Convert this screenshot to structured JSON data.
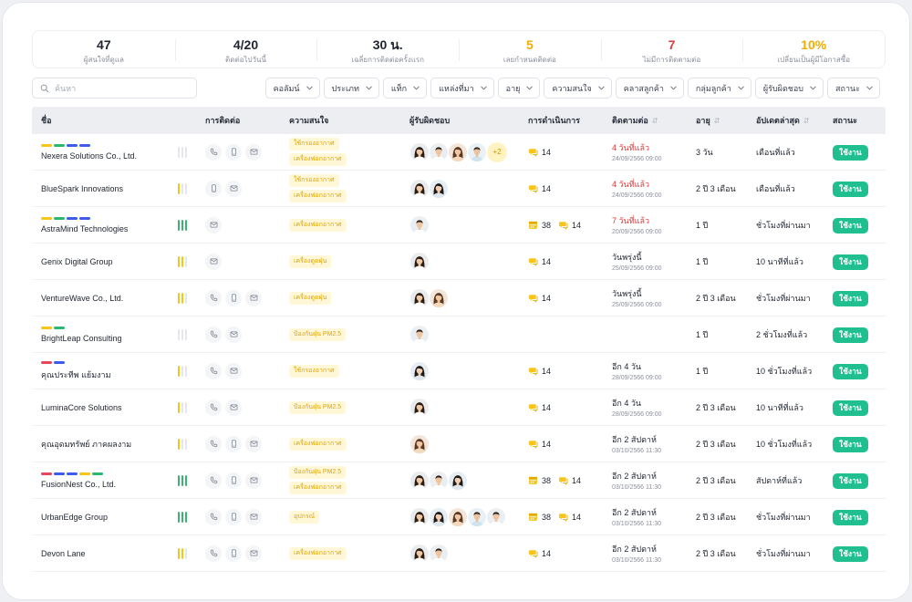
{
  "stats": [
    {
      "value": "47",
      "label": "ผู้สนใจที่ดูแล",
      "color": "#1f2430"
    },
    {
      "value": "4/20",
      "label": "ติดต่อไปวันนี้",
      "color": "#1f2430"
    },
    {
      "value": "30 น.",
      "label": "เฉลี่ยการติดต่อครั้งแรก",
      "color": "#1f2430"
    },
    {
      "value": "5",
      "label": "เลยกำหนดติดต่อ",
      "color": "#f0ad00"
    },
    {
      "value": "7",
      "label": "ไม่มีการติดตามต่อ",
      "color": "#e03a3a"
    },
    {
      "value": "10%",
      "label": "เปลี่ยนเป็นผู้มีโอกาสซื้อ",
      "color": "#f0ad00"
    }
  ],
  "search": {
    "placeholder": "ค้นหา",
    "value": ""
  },
  "filters": [
    "คอลัมน์",
    "ประเภท",
    "แท็ก",
    "แหล่งที่มา",
    "อายุ",
    "ความสนใจ",
    "คลาสลูกค้า",
    "กลุ่มลูกค้า",
    "ผู้รับผิดชอบ",
    "สถานะ"
  ],
  "columns": {
    "name": "ชื่อ",
    "contact": "การติดต่อ",
    "interest": "ความสนใจ",
    "owner": "ผู้รับผิดชอบ",
    "activity": "การดำเนินการ",
    "follow": "ติดตามต่อ",
    "age": "อายุ",
    "updated": "อัปเดตล่าสุด",
    "status": "สถานะ"
  },
  "rows": [
    {
      "name": "Nexera Solutions Co., Ltd.",
      "tags": [
        "yellow",
        "green",
        "blue",
        "blue"
      ],
      "signal": {
        "color": "grey",
        "level": 0
      },
      "contact": [
        "phone-icon",
        "mobile-icon",
        "mail-icon"
      ],
      "interests": [
        "ใช้กรองอากาศ",
        "เครื่องฟอกอากาศ"
      ],
      "avatars": [
        "w1",
        "m1",
        "w2",
        "m2"
      ],
      "more": "+2",
      "act": {
        "cal": null,
        "chat": "14"
      },
      "follow": "4 วันที่แล้ว",
      "overdue": true,
      "follow_date": "24/09/2566 09:00",
      "age": "3 วัน",
      "updated": "เดือนที่แล้ว",
      "status": "ใช้งาน"
    },
    {
      "name": "BlueSpark Innovations",
      "tags": [],
      "signal": {
        "color": "yellow",
        "level": 1
      },
      "contact": [
        "mobile-icon",
        "mail-icon"
      ],
      "interests": [
        "ใช้กรองอากาศ",
        "เครื่องฟอกอากาศ"
      ],
      "avatars": [
        "w1",
        "w3"
      ],
      "more": null,
      "act": {
        "cal": null,
        "chat": "14"
      },
      "follow": "4 วันที่แล้ว",
      "overdue": true,
      "follow_date": "24/09/2566 09:00",
      "age": "2 ปี 3 เดือน",
      "updated": "เดือนที่แล้ว",
      "status": "ใช้งาน"
    },
    {
      "name": "AstraMind Technologies",
      "tags": [
        "yellow",
        "green",
        "blue",
        "blue"
      ],
      "signal": {
        "color": "green",
        "level": 3
      },
      "contact": [
        "mail-icon"
      ],
      "interests": [
        "เครื่องฟอกอากาศ"
      ],
      "avatars": [
        "m1"
      ],
      "more": null,
      "act": {
        "cal": "38",
        "chat": "14"
      },
      "follow": "7 วันที่แล้ว",
      "overdue": true,
      "follow_date": "20/09/2566 09:00",
      "age": "1 ปี",
      "updated": "ชั่วโมงที่ผ่านมา",
      "status": "ใช้งาน"
    },
    {
      "name": "Genix Digital Group",
      "tags": [],
      "signal": {
        "color": "yellow",
        "level": 2
      },
      "contact": [
        "mail-icon"
      ],
      "interests": [
        "เครื่องดูดฝุ่น"
      ],
      "avatars": [
        "w1"
      ],
      "more": null,
      "act": {
        "cal": null,
        "chat": "14"
      },
      "follow": "วันพรุ่งนี้",
      "overdue": false,
      "follow_date": "25/09/2566 09:00",
      "age": "1 ปี",
      "updated": "10 นาทีที่แล้ว",
      "status": "ใช้งาน"
    },
    {
      "name": "VentureWave Co., Ltd.",
      "tags": [],
      "signal": {
        "color": "yellow",
        "level": 2
      },
      "contact": [
        "phone-icon",
        "mobile-icon",
        "mail-icon"
      ],
      "interests": [
        "เครื่องดูดฝุ่น"
      ],
      "avatars": [
        "w1",
        "w2"
      ],
      "more": null,
      "act": {
        "cal": null,
        "chat": "14"
      },
      "follow": "วันพรุ่งนี้",
      "overdue": false,
      "follow_date": "25/09/2566 09:00",
      "age": "2 ปี 3 เดือน",
      "updated": "ชั่วโมงที่ผ่านมา",
      "status": "ใช้งาน"
    },
    {
      "name": "BrightLeap Consulting",
      "tags": [
        "yellow",
        "green"
      ],
      "signal": {
        "color": "grey",
        "level": 0
      },
      "contact": [
        "phone-icon",
        "mail-icon"
      ],
      "interests": [
        "ป้องกันฝุ่น PM2.5"
      ],
      "avatars": [
        "m1"
      ],
      "more": null,
      "act": {
        "cal": null,
        "chat": null
      },
      "follow": "",
      "overdue": false,
      "follow_date": "",
      "age": "1 ปี",
      "updated": "2 ชั่วโมงที่แล้ว",
      "status": "ใช้งาน"
    },
    {
      "name": "คุณประทีพ แย้มงาม",
      "tags": [
        "red",
        "blue"
      ],
      "signal": {
        "color": "yellow",
        "level": 1
      },
      "contact": [
        "phone-icon",
        "mail-icon"
      ],
      "interests": [
        "ใช้กรองอากาศ"
      ],
      "avatars": [
        "w3"
      ],
      "more": null,
      "act": {
        "cal": null,
        "chat": "14"
      },
      "follow": "อีก 4 วัน",
      "overdue": false,
      "follow_date": "28/09/2566 09:00",
      "age": "1 ปี",
      "updated": "10 ชั่วโมงที่แล้ว",
      "status": "ใช้งาน"
    },
    {
      "name": "LuminaCore Solutions",
      "tags": [],
      "signal": {
        "color": "yellow",
        "level": 1
      },
      "contact": [
        "phone-icon",
        "mail-icon"
      ],
      "interests": [
        "ป้องกันฝุ่น PM2.5"
      ],
      "avatars": [
        "w1"
      ],
      "more": null,
      "act": {
        "cal": null,
        "chat": "14"
      },
      "follow": "อีก 4 วัน",
      "overdue": false,
      "follow_date": "28/09/2566 09:00",
      "age": "2 ปี 3 เดือน",
      "updated": "10 นาทีที่แล้ว",
      "status": "ใช้งาน"
    },
    {
      "name": "คุณอุดมทรัพย์ ภาคผลงาม",
      "tags": [],
      "signal": {
        "color": "yellow",
        "level": 1
      },
      "contact": [
        "phone-icon",
        "mobile-icon",
        "mail-icon"
      ],
      "interests": [
        "เครื่องฟอกอากาศ"
      ],
      "avatars": [
        "w2"
      ],
      "more": null,
      "act": {
        "cal": null,
        "chat": "14"
      },
      "follow": "อีก 2 สัปดาห์",
      "overdue": false,
      "follow_date": "03/10/2566 11:30",
      "age": "2 ปี 3 เดือน",
      "updated": "10 ชั่วโมงที่แล้ว",
      "status": "ใช้งาน"
    },
    {
      "name": "FusionNest Co., Ltd.",
      "tags": [
        "red",
        "blue",
        "blue",
        "yellow",
        "green"
      ],
      "signal": {
        "color": "green",
        "level": 3
      },
      "contact": [
        "phone-icon",
        "mobile-icon",
        "mail-icon"
      ],
      "interests": [
        "ป้องกันฝุ่น PM2.5",
        "เครื่องฟอกอากาศ"
      ],
      "avatars": [
        "w1",
        "m1",
        "w3"
      ],
      "more": null,
      "act": {
        "cal": "38",
        "chat": "14"
      },
      "follow": "อีก 2 สัปดาห์",
      "overdue": false,
      "follow_date": "03/10/2566 11:30",
      "age": "2 ปี 3 เดือน",
      "updated": "สัปดาห์ที่แล้ว",
      "status": "ใช้งาน"
    },
    {
      "name": "UrbanEdge Group",
      "tags": [],
      "signal": {
        "color": "green",
        "level": 3
      },
      "contact": [
        "phone-icon",
        "mobile-icon",
        "mail-icon"
      ],
      "interests": [
        "อุปกรณ์"
      ],
      "avatars": [
        "w1",
        "w3",
        "w2",
        "m2",
        "m1"
      ],
      "more": null,
      "act": {
        "cal": "38",
        "chat": "14"
      },
      "follow": "อีก 2 สัปดาห์",
      "overdue": false,
      "follow_date": "03/10/2566 11:30",
      "age": "2 ปี 3 เดือน",
      "updated": "ชั่วโมงที่ผ่านมา",
      "status": "ใช้งาน"
    },
    {
      "name": "Devon Lane",
      "tags": [],
      "signal": {
        "color": "yellow",
        "level": 2
      },
      "contact": [
        "phone-icon",
        "mobile-icon",
        "mail-icon"
      ],
      "interests": [
        "เครื่องฟอกอากาศ"
      ],
      "avatars": [
        "w1",
        "m1"
      ],
      "more": null,
      "act": {
        "cal": null,
        "chat": "14"
      },
      "follow": "อีก 2 สัปดาห์",
      "overdue": false,
      "follow_date": "03/10/2566 11:30",
      "age": "2 ปี 3 เดือน",
      "updated": "ชั่วโมงที่ผ่านมา",
      "status": "ใช้งาน"
    }
  ]
}
